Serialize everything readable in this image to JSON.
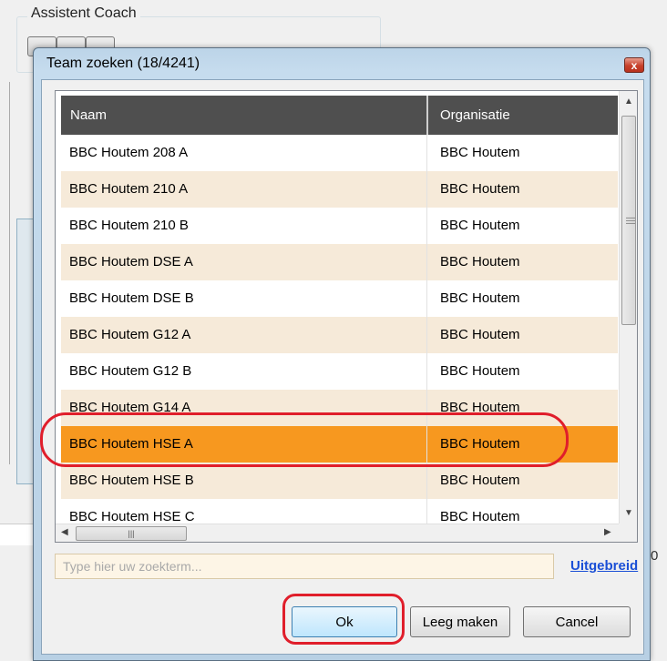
{
  "background": {
    "group_title": "Assistent Coach",
    "right_fragment": "0"
  },
  "dialog": {
    "title": "Team zoeken (18/4241)",
    "close_glyph": "x"
  },
  "grid": {
    "columns": [
      "Naam",
      "Organisatie"
    ],
    "rows": [
      {
        "name": "BBC Houtem 208 A",
        "org": "BBC Houtem"
      },
      {
        "name": "BBC Houtem 210 A",
        "org": "BBC Houtem"
      },
      {
        "name": "BBC Houtem 210 B",
        "org": "BBC Houtem"
      },
      {
        "name": "BBC Houtem DSE A",
        "org": "BBC Houtem"
      },
      {
        "name": "BBC Houtem DSE B",
        "org": "BBC Houtem"
      },
      {
        "name": "BBC Houtem G12 A",
        "org": "BBC Houtem"
      },
      {
        "name": "BBC Houtem G12 B",
        "org": "BBC Houtem"
      },
      {
        "name": "BBC Houtem G14 A",
        "org": "BBC Houtem"
      },
      {
        "name": "BBC Houtem HSE A",
        "org": "BBC Houtem"
      },
      {
        "name": "BBC Houtem HSE B",
        "org": "BBC Houtem"
      },
      {
        "name": "BBC Houtem HSE C",
        "org": "BBC Houtem"
      }
    ],
    "selected_index": 8,
    "row_colors": {
      "odd": "#ffffff",
      "even": "#f6ead9",
      "selected": "#f7981f",
      "header": "#4f4f4f"
    }
  },
  "search": {
    "placeholder": "Type hier uw zoekterm...",
    "value": "",
    "advanced_link": "Uitgebreid"
  },
  "buttons": {
    "ok": "Ok",
    "clear": "Leeg maken",
    "cancel": "Cancel"
  },
  "annotation_color": "#e01e2b",
  "icons": [
    "close-icon",
    "scroll-up-arrow-icon",
    "scroll-down-arrow-icon",
    "scroll-left-arrow-icon",
    "scroll-right-arrow-icon",
    "grip-icon"
  ]
}
